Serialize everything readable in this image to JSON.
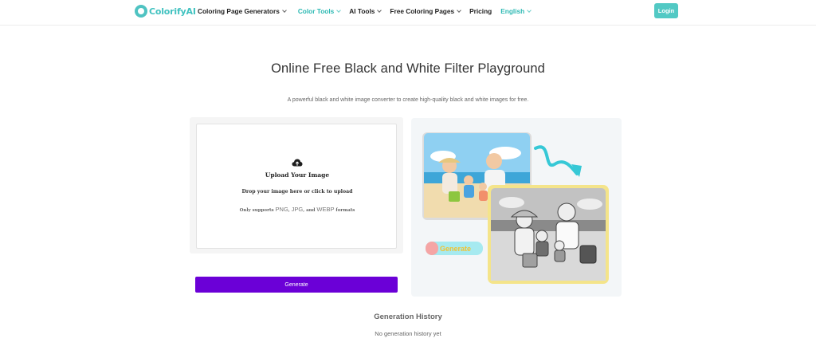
{
  "brand": {
    "name": "ColorifyAI"
  },
  "nav": {
    "items": [
      {
        "label": "Coloring Page Generators",
        "has_dropdown": true
      },
      {
        "label": "Color Tools",
        "has_dropdown": true
      },
      {
        "label": "AI Tools",
        "has_dropdown": true
      },
      {
        "label": "Free Coloring Pages",
        "has_dropdown": true
      },
      {
        "label": "Pricing",
        "has_dropdown": false
      },
      {
        "label": "English",
        "has_dropdown": true
      }
    ],
    "login_label": "Login"
  },
  "main": {
    "title": "Online Free Black and White Filter Playground",
    "subtitle": "A powerful black and white image converter to create high-quality black and white images for free.",
    "upload": {
      "title": "Upload Your Image",
      "drop_text": "Drop your image here or click to upload",
      "support_prefix": "Only supports ",
      "format_png": "PNG",
      "sep1": ", ",
      "format_jpg": "JPG",
      "sep2": ", and ",
      "format_webp": "WEBP",
      "support_suffix": " formats"
    },
    "generate_label": "Generate",
    "preview": {
      "badge_label": "Generate"
    }
  },
  "history": {
    "title": "Generation History",
    "empty_text": "No generation history yet"
  },
  "colors": {
    "accent": "#2cb9b3",
    "login": "#52c9c4",
    "generate": "#6b00d7",
    "badge": "#a6eaf0"
  },
  "icons": [
    "logo-icon",
    "chevron-down-icon",
    "cloud-upload-icon",
    "arrow-curve-icon"
  ]
}
